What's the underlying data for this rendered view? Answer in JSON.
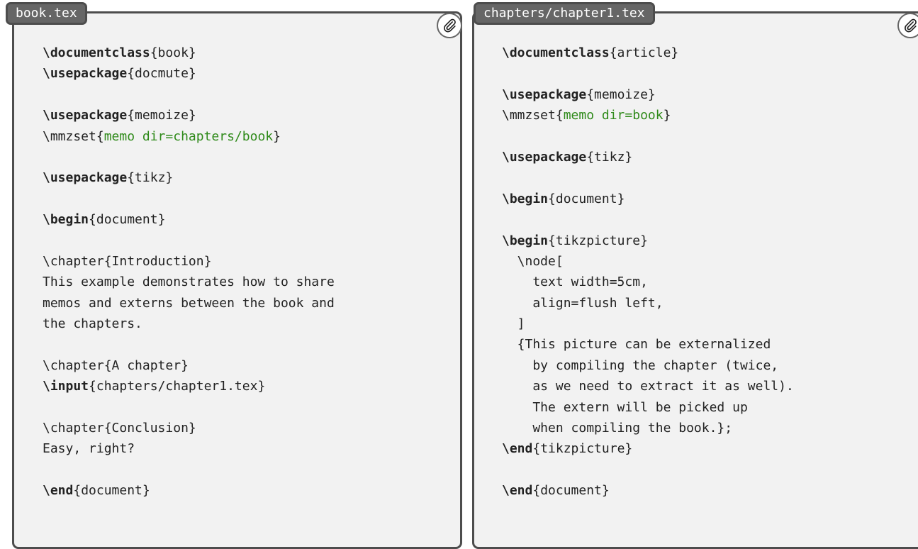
{
  "colors": {
    "panel_bg": "#f2f2f2",
    "frame": "#4d4d4d",
    "tab_bg": "#666666",
    "tab_text": "#ffffff",
    "code_text": "#222222",
    "option_text": "#2f8a1a"
  },
  "left": {
    "tab_label": "book.tex",
    "attachment_icon": "paperclip-icon",
    "lines": [
      [
        {
          "t": "\\documentclass",
          "k": "kw"
        },
        {
          "t": "{book}"
        }
      ],
      [
        {
          "t": "\\usepackage",
          "k": "kw"
        },
        {
          "t": "{docmute}"
        }
      ],
      [],
      [
        {
          "t": "\\usepackage",
          "k": "kw"
        },
        {
          "t": "{memoize}"
        }
      ],
      [
        {
          "t": "\\mmzset{"
        },
        {
          "t": "memo dir=chapters/book",
          "k": "opt"
        },
        {
          "t": "}"
        }
      ],
      [],
      [
        {
          "t": "\\usepackage",
          "k": "kw"
        },
        {
          "t": "{tikz}"
        }
      ],
      [],
      [
        {
          "t": "\\begin",
          "k": "kw"
        },
        {
          "t": "{document}"
        }
      ],
      [],
      [
        {
          "t": "\\chapter{Introduction}"
        }
      ],
      [
        {
          "t": "This example demonstrates how to share"
        }
      ],
      [
        {
          "t": "memos and externs between the book and"
        }
      ],
      [
        {
          "t": "the chapters."
        }
      ],
      [],
      [
        {
          "t": "\\chapter{A chapter}"
        }
      ],
      [
        {
          "t": "\\input",
          "k": "kw"
        },
        {
          "t": "{chapters/chapter1.tex}"
        }
      ],
      [],
      [
        {
          "t": "\\chapter{Conclusion}"
        }
      ],
      [
        {
          "t": "Easy, right?"
        }
      ],
      [],
      [
        {
          "t": "\\end",
          "k": "kw"
        },
        {
          "t": "{document}"
        }
      ]
    ]
  },
  "right": {
    "tab_label": "chapters/chapter1.tex",
    "attachment_icon": "paperclip-icon",
    "lines": [
      [
        {
          "t": "\\documentclass",
          "k": "kw"
        },
        {
          "t": "{article}"
        }
      ],
      [],
      [
        {
          "t": "\\usepackage",
          "k": "kw"
        },
        {
          "t": "{memoize}"
        }
      ],
      [
        {
          "t": "\\mmzset{"
        },
        {
          "t": "memo dir=book",
          "k": "opt"
        },
        {
          "t": "}"
        }
      ],
      [],
      [
        {
          "t": "\\usepackage",
          "k": "kw"
        },
        {
          "t": "{tikz}"
        }
      ],
      [],
      [
        {
          "t": "\\begin",
          "k": "kw"
        },
        {
          "t": "{document}"
        }
      ],
      [],
      [
        {
          "t": "\\begin",
          "k": "kw"
        },
        {
          "t": "{tikzpicture}"
        }
      ],
      [
        {
          "t": "  \\node["
        }
      ],
      [
        {
          "t": "    text width=5cm,"
        }
      ],
      [
        {
          "t": "    align=flush left,"
        }
      ],
      [
        {
          "t": "  ]"
        }
      ],
      [
        {
          "t": "  {This picture can be externalized"
        }
      ],
      [
        {
          "t": "    by compiling the chapter (twice,"
        }
      ],
      [
        {
          "t": "    as we need to extract it as well)."
        }
      ],
      [
        {
          "t": "    The extern will be picked up"
        }
      ],
      [
        {
          "t": "    when compiling the book.};"
        }
      ],
      [
        {
          "t": "\\end",
          "k": "kw"
        },
        {
          "t": "{tikzpicture}"
        }
      ],
      [],
      [
        {
          "t": "\\end",
          "k": "kw"
        },
        {
          "t": "{document}"
        }
      ]
    ]
  }
}
